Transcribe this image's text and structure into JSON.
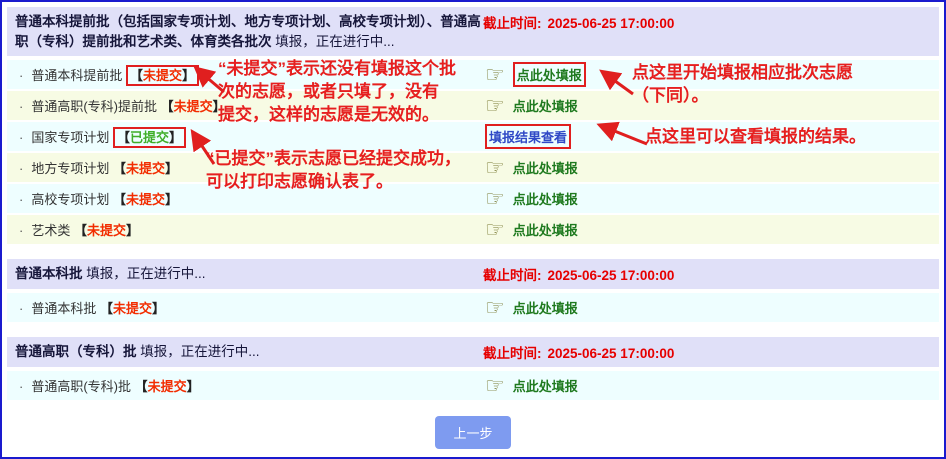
{
  "ui": {
    "bracket_open": "【",
    "bracket_close": "】",
    "bullet": "·",
    "hand_icon": "☞",
    "colors": {
      "header_bg": "#e0e0f8",
      "row_cyan": "#eefeff",
      "row_yellow": "#f7fbe4",
      "deadline_red": "#e60000",
      "status_red": "#f22c00",
      "status_green": "#3fae29",
      "fill_link_green": "#1f7a1f",
      "result_link_blue": "#2f49c6",
      "annotation_red": "#e61f1f",
      "button_blue": "#7e9bf0",
      "border_blue": "#1a1ace"
    }
  },
  "sections": [
    {
      "title_bold": "普通本科提前批（包括国家专项计划、地方专项计划、高校专项计划）、普通高职（专科）提前批和艺术类、体育类各批次",
      "title_rest": " 填报，正在进行中...",
      "deadline_label": "截止时间:",
      "deadline_value": "2025-06-25 17:00:00",
      "rows": [
        {
          "name": "普通本科提前批",
          "status": "未提交",
          "action": "点此处填报"
        },
        {
          "name": "普通高职(专科)提前批",
          "status": "未提交",
          "action": "点此处填报"
        },
        {
          "name": "国家专项计划",
          "status": "已提交",
          "action": "填报结果查看"
        },
        {
          "name": "地方专项计划",
          "status": "未提交",
          "action": "点此处填报"
        },
        {
          "name": "高校专项计划",
          "status": "未提交",
          "action": "点此处填报"
        },
        {
          "name": "艺术类",
          "status": "未提交",
          "action": "点此处填报"
        }
      ]
    },
    {
      "title_bold": "普通本科批",
      "title_rest": " 填报，正在进行中...",
      "deadline_label": "截止时间:",
      "deadline_value": "2025-06-25 17:00:00",
      "rows": [
        {
          "name": "普通本科批",
          "status": "未提交",
          "action": "点此处填报"
        }
      ]
    },
    {
      "title_bold": "普通高职（专科）批",
      "title_rest": " 填报，正在进行中...",
      "deadline_label": "截止时间:",
      "deadline_value": "2025-06-25 17:00:00",
      "rows": [
        {
          "name": "普通高职(专科)批",
          "status": "未提交",
          "action": "点此处填报"
        }
      ]
    }
  ],
  "annotations": [
    {
      "text": "“未提交”表示还没有填报这个批\n次的志愿，或者只填了，没有\n提交，这样的志愿是无效的。"
    },
    {
      "text": "“已提交”表示志愿已经提交成功，\n可以打印志愿确认表了。"
    },
    {
      "text": "点这里开始填报相应批次志愿\n（下同）。"
    },
    {
      "text": "点这里可以查看填报的结果。"
    }
  ],
  "footer": {
    "back_button": "上一步"
  }
}
